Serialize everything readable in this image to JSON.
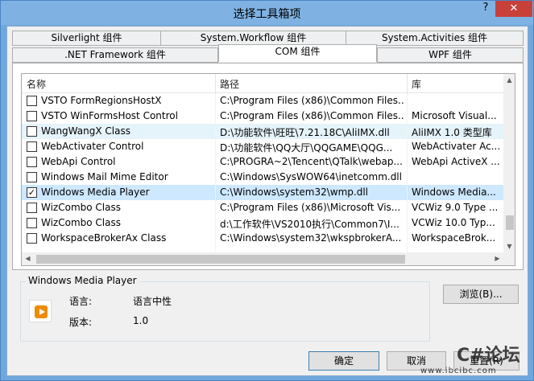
{
  "window": {
    "title": "选择工具箱项",
    "help": "?",
    "close": "✕"
  },
  "tabs": {
    "row1": [
      "Silverlight 组件",
      "System.Workflow 组件",
      "System.Activities 组件"
    ],
    "row2": [
      ".NET Framework 组件",
      "COM 组件",
      "WPF 组件"
    ],
    "active": "COM 组件"
  },
  "list": {
    "columns": [
      "名称",
      "路径",
      "库"
    ],
    "rows": [
      {
        "checked": false,
        "name": "VSTO FormRegionsHostX",
        "path": "C:\\Program Files (x86)\\Common Files...",
        "lib": ""
      },
      {
        "checked": false,
        "name": "VSTO WinFormsHost Control",
        "path": "C:\\Program Files (x86)\\Common Files...",
        "lib": "Microsoft Visual..."
      },
      {
        "checked": false,
        "name": "WangWangX Class",
        "path": "D:\\功能软件\\旺旺\\7.21.18C\\AliIMX.dll",
        "lib": "AliIMX 1.0 类型库"
      },
      {
        "checked": false,
        "name": "WebActivater Control",
        "path": "D:\\功能软件\\QQ大厅\\QQGAME\\QQG...",
        "lib": "WebActivater Ac..."
      },
      {
        "checked": false,
        "name": "WebApi Control",
        "path": "C:\\PROGRA~2\\Tencent\\QTalk\\webap...",
        "lib": "WebApi ActiveX ..."
      },
      {
        "checked": false,
        "name": "Windows Mail Mime Editor",
        "path": "C:\\Windows\\SysWOW64\\inetcomm.dll",
        "lib": ""
      },
      {
        "checked": true,
        "name": "Windows Media Player",
        "path": "C:\\Windows\\system32\\wmp.dll",
        "lib": "Windows Media..."
      },
      {
        "checked": false,
        "name": "WizCombo Class",
        "path": "C:\\Program Files (x86)\\Microsoft Vis...",
        "lib": "VCWiz 9.0 Type ..."
      },
      {
        "checked": false,
        "name": "WizCombo Class",
        "path": "d:\\工作软件\\VS2010执行\\Common7\\I...",
        "lib": "VCWiz 10.0 Typ..."
      },
      {
        "checked": false,
        "name": "WorkspaceBrokerAx Class",
        "path": "C:\\Windows\\system32\\wkspbrokerA...",
        "lib": "WorkspaceBrok..."
      }
    ]
  },
  "details": {
    "legend": "Windows Media Player",
    "language_label": "语言:",
    "language_value": "语言中性",
    "version_label": "版本:",
    "version_value": "1.0"
  },
  "buttons": {
    "browse": "浏览(B)...",
    "ok": "确定",
    "cancel": "取消",
    "reset": "重置(R)"
  },
  "watermark": {
    "logo": "C#论坛",
    "url": "www.ibcibc.com"
  },
  "colors": {
    "selected_row": "#cde8ff",
    "hover_row": "#e5f3fb",
    "close_button": "#c7403a",
    "window_frame": "#6fa8dc"
  }
}
